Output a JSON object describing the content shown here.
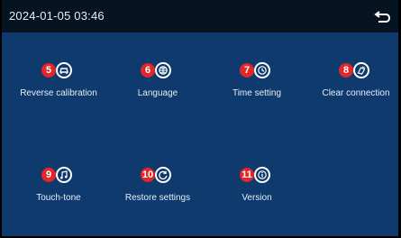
{
  "topbar": {
    "datetime": "2024-01-05  03:46"
  },
  "items": [
    {
      "badge": "5",
      "label": "Reverse calibration",
      "icon": "car-icon"
    },
    {
      "badge": "6",
      "label": "Language",
      "icon": "globe-icon"
    },
    {
      "badge": "7",
      "label": "Time setting",
      "icon": "clock-icon"
    },
    {
      "badge": "8",
      "label": "Clear connection",
      "icon": "clear-icon"
    },
    {
      "badge": "9",
      "label": "Touch-tone",
      "icon": "music-note-icon"
    },
    {
      "badge": "10",
      "label": "Restore settings",
      "icon": "refresh-icon"
    },
    {
      "badge": "11",
      "label": "Version",
      "icon": "info-icon"
    }
  ],
  "colors": {
    "background": "#0f3a6d",
    "topbar": "#061320",
    "badge": "#e3262a",
    "text": "#e6edf7"
  }
}
